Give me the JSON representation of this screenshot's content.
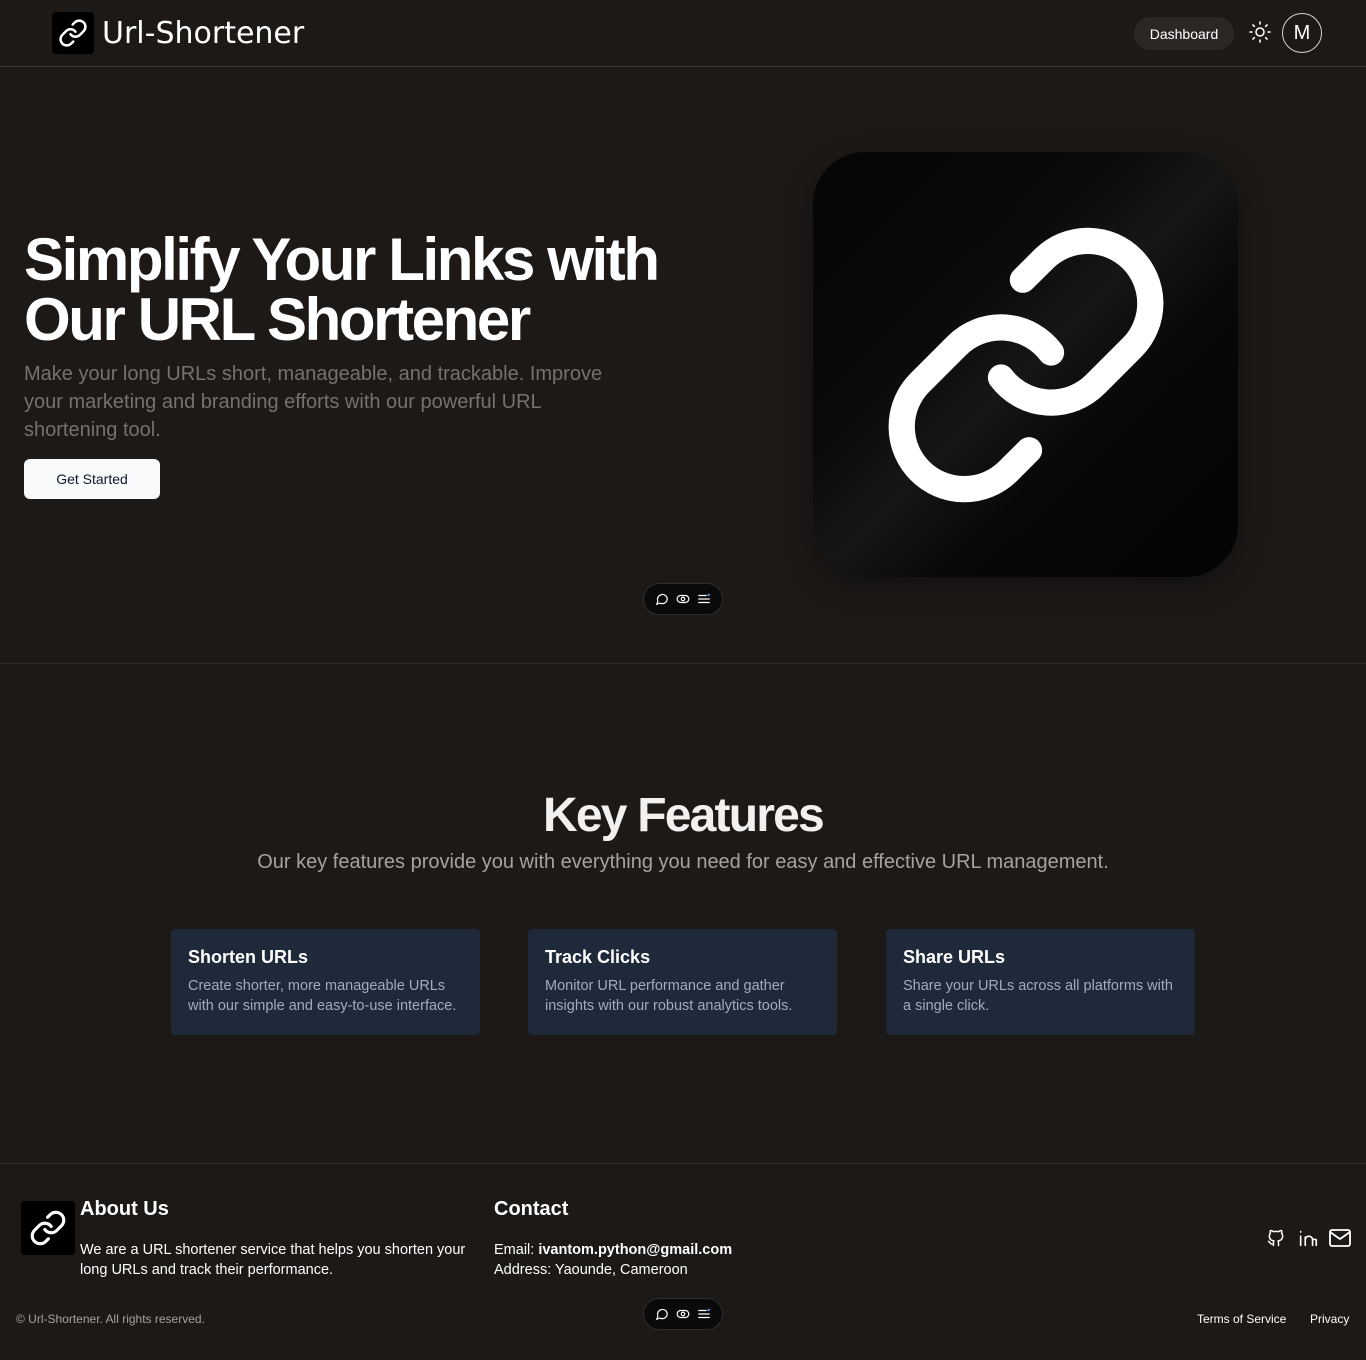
{
  "header": {
    "brand": "Url-Shortener",
    "logo_icon": "link-icon",
    "dashboard_label": "Dashboard",
    "theme_icon": "sun-icon",
    "avatar_initial": "M"
  },
  "hero": {
    "title_line1": "Simplify Your Links with",
    "title_line2": "Our URL Shortener",
    "subtitle": "Make your long URLs short, manageable, and trackable. Improve your marketing and branding efforts with our powerful URL shortening tool.",
    "cta_label": "Get Started",
    "art_icon": "link-icon"
  },
  "toolbar_pill": {
    "icons": [
      "comment-icon",
      "eye-icon",
      "menu-icon"
    ]
  },
  "features": {
    "title": "Key Features",
    "subtitle": "Our key features provide you with everything you need for easy and effective URL management.",
    "cards": [
      {
        "title": "Shorten URLs",
        "text": "Create shorter, more manageable URLs with our simple and easy-to-use interface."
      },
      {
        "title": "Track Clicks",
        "text": "Monitor URL performance and gather insights with our robust analytics tools."
      },
      {
        "title": "Share URLs",
        "text": "Share your URLs across all platforms with a single click."
      }
    ]
  },
  "footer": {
    "about_title": "About Us",
    "about_text": "We are a URL shortener service that helps you shorten your long URLs and track their performance.",
    "contact_title": "Contact",
    "email_label": "Email:",
    "email_value": "ivantom.python@gmail.com",
    "address": "Address: Yaounde, Cameroon",
    "socials": [
      "github-icon",
      "linkedin-icon",
      "mail-icon"
    ],
    "copyright": "© Url-Shortener. All rights reserved.",
    "terms": "Terms of Service",
    "privacy": "Privacy"
  },
  "colors": {
    "background": "#1c1917",
    "card": "#1e2939",
    "muted_text": "#78716c"
  }
}
